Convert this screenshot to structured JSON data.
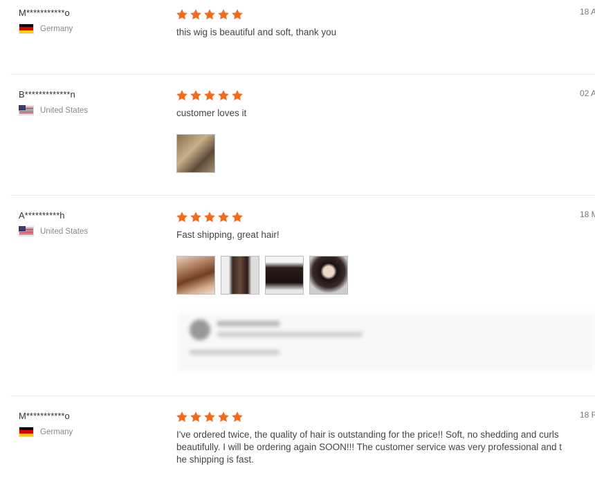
{
  "reviews": [
    {
      "user": "M***********o",
      "country": "Germany",
      "flag": "de",
      "rating": 5,
      "text": "this wig is beautiful and soft, thank you",
      "date": "18 A"
    },
    {
      "user": "B*************n",
      "country": "United States",
      "flag": "us",
      "rating": 5,
      "text": "customer loves it",
      "date": "02 A",
      "photos": 1
    },
    {
      "user": "A**********h",
      "country": "United States",
      "flag": "us",
      "rating": 5,
      "text": "Fast shipping, great hair!",
      "date": "18 M",
      "photos": 4
    },
    {
      "user": "M***********o",
      "country": "Germany",
      "flag": "de",
      "rating": 5,
      "text": "I've ordered twice, the quality of hair is outstanding for the price!!  Soft, no shedding and curls beautifully. I will be ordering again SOON!!! The customer service was very professional and the shipping is fast.",
      "date": "18 F"
    }
  ],
  "star_color": "#f26b1d"
}
